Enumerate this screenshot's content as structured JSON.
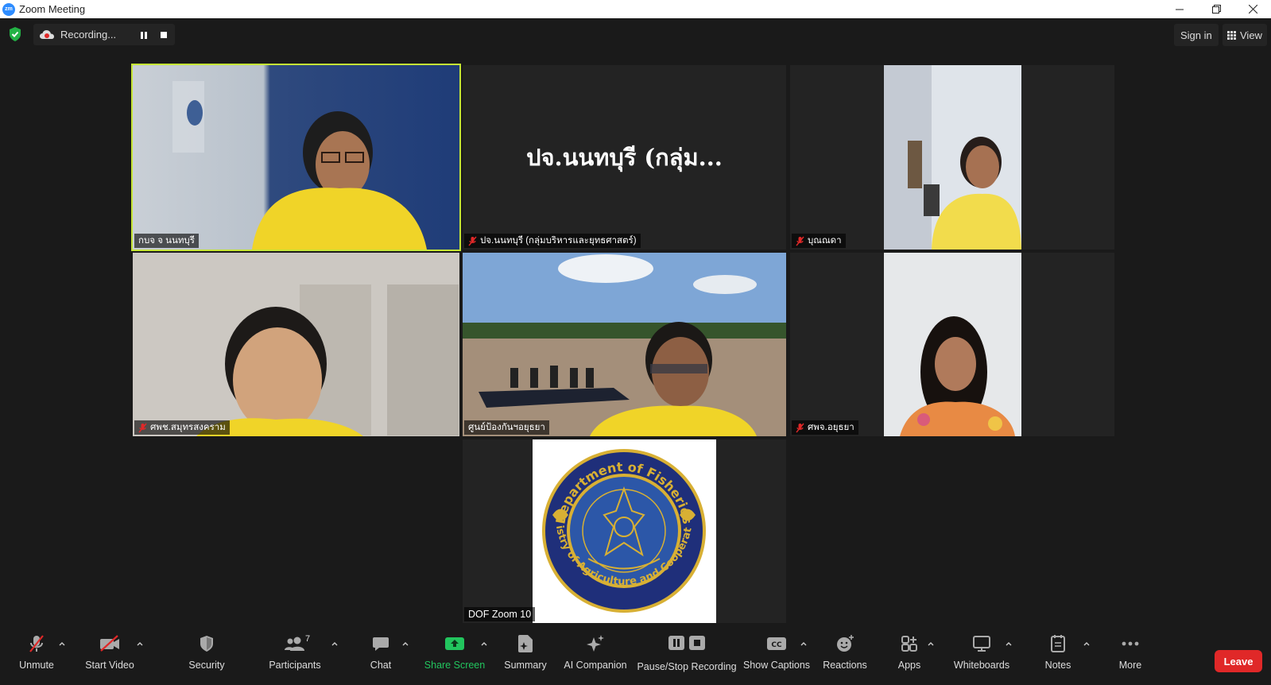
{
  "window": {
    "title": "Zoom Meeting",
    "logo_text": "zm",
    "controls": [
      "minimize",
      "restore",
      "close"
    ]
  },
  "topbar": {
    "recording_label": "Recording...",
    "sign_in_label": "Sign in",
    "view_label": "View"
  },
  "tiles": [
    {
      "name": "กบจ จ นนทบุรี",
      "muted": false,
      "active": true,
      "video": "speaker-woman-glasses"
    },
    {
      "name": "ปจ.นนทบุรี (กลุ่มบริหารและยุทธศาสตร์)",
      "display_name": "ปจ.นนทบุรี (กลุ่ม...",
      "muted": true,
      "video": "none"
    },
    {
      "name": "บุณณดา",
      "muted": true,
      "video": "woman-office"
    },
    {
      "name": "ศพช.สมุทรสงคราม",
      "muted": true,
      "video": "man-looking-down"
    },
    {
      "name": "ศูนย์ป้องกันฯอยุธยา",
      "muted": false,
      "video": "man-river-boat"
    },
    {
      "name": "ศพจ.อยุธยา",
      "muted": true,
      "video": "woman-smiling"
    },
    {
      "name": "DOF Zoom 10",
      "muted": false,
      "video": "department-logo"
    }
  ],
  "logo": {
    "top_text": "Department of Fisheries",
    "bottom_text": "Ministry of Agriculture and Cooperatives",
    "colors": {
      "ring": "#1f2f7a",
      "gold": "#d8b034",
      "inner": "#2c57a8"
    }
  },
  "toolbar": {
    "unmute": "Unmute",
    "start_video": "Start Video",
    "security": "Security",
    "participants": "Participants",
    "participants_count": "7",
    "chat": "Chat",
    "share_screen": "Share Screen",
    "summary": "Summary",
    "ai_companion": "AI Companion",
    "pause_stop_recording": "Pause/Stop Recording",
    "show_captions": "Show Captions",
    "reactions": "Reactions",
    "apps": "Apps",
    "whiteboards": "Whiteboards",
    "notes": "Notes",
    "more": "More",
    "leave": "Leave"
  },
  "colors": {
    "background": "#1a1a1a",
    "active_speaker": "#c5e535",
    "share_green": "#22c55e",
    "leave_red": "#e02828",
    "mute_red": "#e02828"
  }
}
